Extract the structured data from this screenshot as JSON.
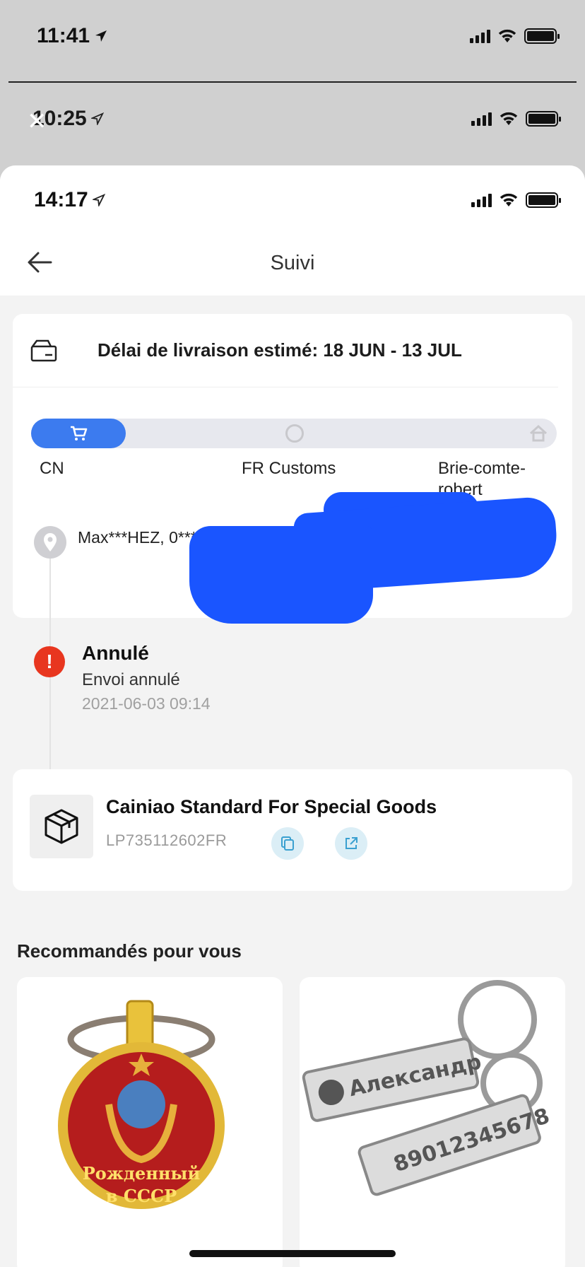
{
  "status_bars": [
    {
      "time": "11:41"
    },
    {
      "time": "10:25"
    },
    {
      "time": "14:17"
    }
  ],
  "header": {
    "title": "Suivi"
  },
  "delivery": {
    "estimate": "Délai de livraison estimé: 18 JUN - 13 JUL",
    "progress_fraction": 0.18,
    "stages": [
      "CN",
      "FR Customs",
      "Brie-comte-\nrobert"
    ]
  },
  "address": {
    "text": "Max***HEZ,  0*****5**** sports,,,  Brie Marne,  Franc"
  },
  "event": {
    "title": "Annulé",
    "subtitle": "Envoi annulé",
    "timestamp": "2021-06-03 09:14"
  },
  "shipping": {
    "carrier": "Cainiao Standard For Special Goods",
    "tracking_number": "LP735112602FR"
  },
  "recommended": {
    "title": "Recommandés pour vous",
    "products": [
      {
        "badge_text": [
          "Рожденный",
          "в  СССР"
        ]
      },
      {
        "tag_texts": [
          "Александр",
          "89012345678"
        ]
      }
    ]
  },
  "colors": {
    "accent": "#3c7bef",
    "error": "#e8361f",
    "redaction": "#1a55ff"
  }
}
